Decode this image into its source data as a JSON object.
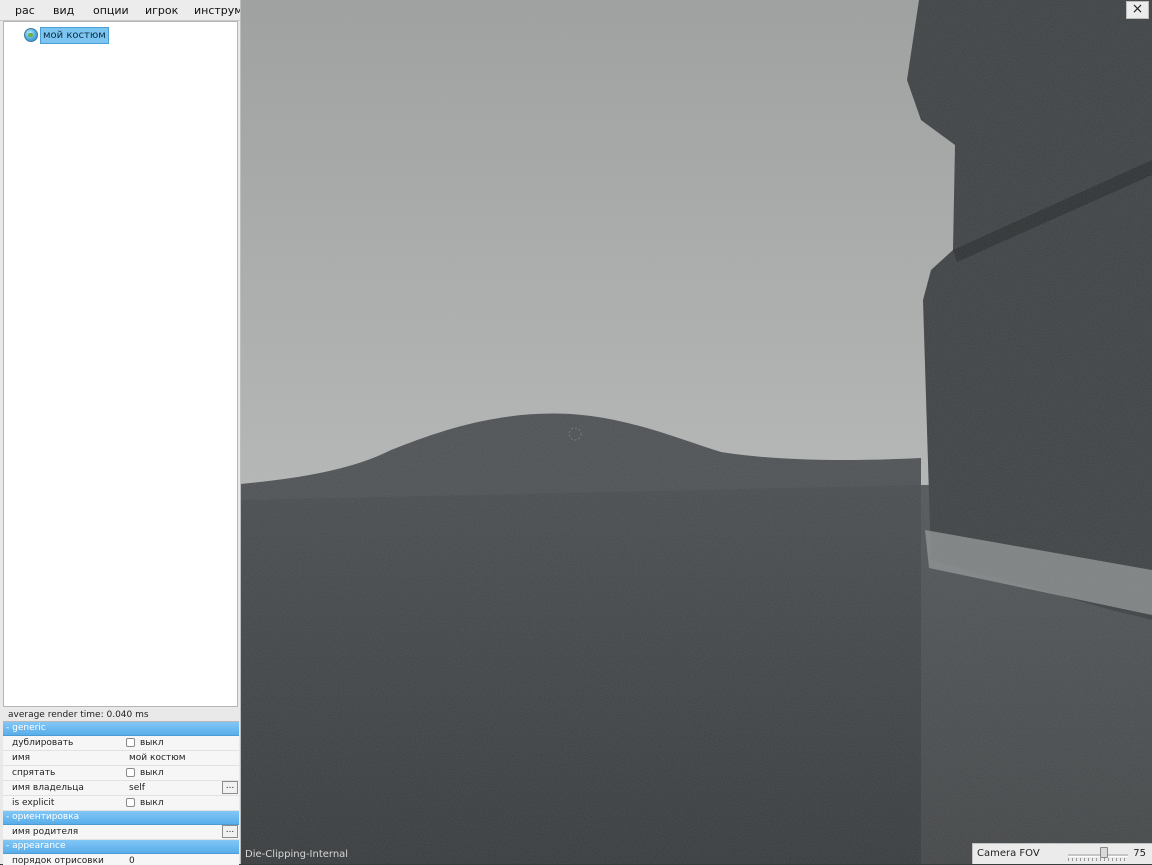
{
  "menu": {
    "items": [
      "рас",
      "вид",
      "опции",
      "игрок",
      "инструме"
    ]
  },
  "tree": {
    "node_label": "мой костюм",
    "node_icon": "globe-icon"
  },
  "status": {
    "render_time": "average render time: 0.040 ms"
  },
  "properties": {
    "section_generic": "- generic",
    "duplicate_label": "дублировать",
    "duplicate_value": "выкл",
    "name_label": "имя",
    "name_value": "мой костюм",
    "hide_label": "спрятать",
    "hide_value": "выкл",
    "owner_label": "имя владельца",
    "owner_value": "self",
    "owner_button": "...",
    "explicit_label": "is explicit",
    "explicit_value": "выкл",
    "section_orientation": "- ориентировка",
    "parent_label": "имя родителя",
    "parent_button": "...",
    "section_appearance": "- appearance",
    "draw_order_label": "порядок отрисовки",
    "draw_order_value": "0"
  },
  "viewport": {
    "label": "Die-Clipping-Internal",
    "close_glyph": "×"
  },
  "camera": {
    "fov_label": "Camera FOV",
    "fov_value": "75",
    "fov_fraction": 0.6
  },
  "colors": {
    "selection": "#7cc5f0",
    "section_header": "#6ab9ef",
    "sky": "#a9abab",
    "ground": "#3b3f42"
  }
}
